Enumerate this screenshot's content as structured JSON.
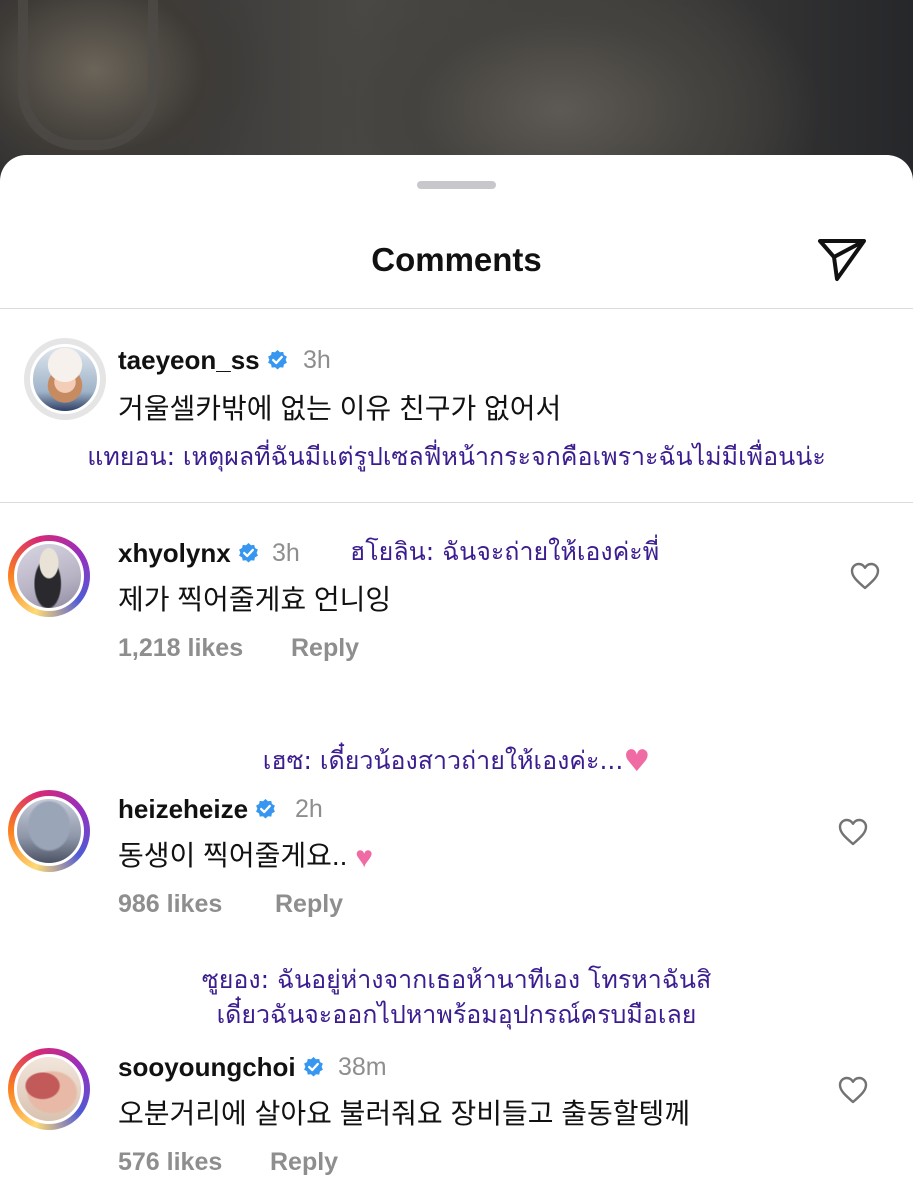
{
  "header": {
    "title": "Comments"
  },
  "caption": {
    "username": "taeyeon_ss",
    "time": "3h",
    "text": "거울셀카밖에 없는 이유 친구가 없어서",
    "translation": "แทยอน: เหตุผลที่ฉันมีแต่รูปเซลฟี่หน้ากระจกคือเพราะฉันไม่มีเพื่อนน่ะ"
  },
  "comments": [
    {
      "username": "xhyolynx",
      "time": "3h",
      "text": "제가 찍어줄게효 언니잉",
      "likes": "1,218 likes",
      "reply": "Reply",
      "translation": "ฮโยลิน: ฉันจะถ่ายให้เองค่ะพี่"
    },
    {
      "username": "heizeheize",
      "time": "2h",
      "text": "동생이 찍어줄게요..",
      "likes": "986 likes",
      "reply": "Reply",
      "translation": "เฮซ: เดี๋ยวน้องสาวถ่ายให้เองค่ะ..."
    },
    {
      "username": "sooyoungchoi",
      "time": "38m",
      "text": "오분거리에 살아요 불러줘요 장비들고 출동할텡께",
      "likes": "576 likes",
      "reply": "Reply",
      "translation_line1": "ซูยอง: ฉันอยู่ห่างจากเธอห้านาทีเอง โทรหาฉันสิ",
      "translation_line2": "เดี๋ยวฉันจะออกไปหาพร้อมอุปกรณ์ครบมือเลย"
    }
  ],
  "colors": {
    "verified": "#3797f0",
    "translation": "#3b1d8f",
    "secondary_text": "#8e8e8e"
  },
  "icons": [
    "send-icon",
    "verified-icon",
    "heart-icon",
    "pink-heart-emoji"
  ]
}
